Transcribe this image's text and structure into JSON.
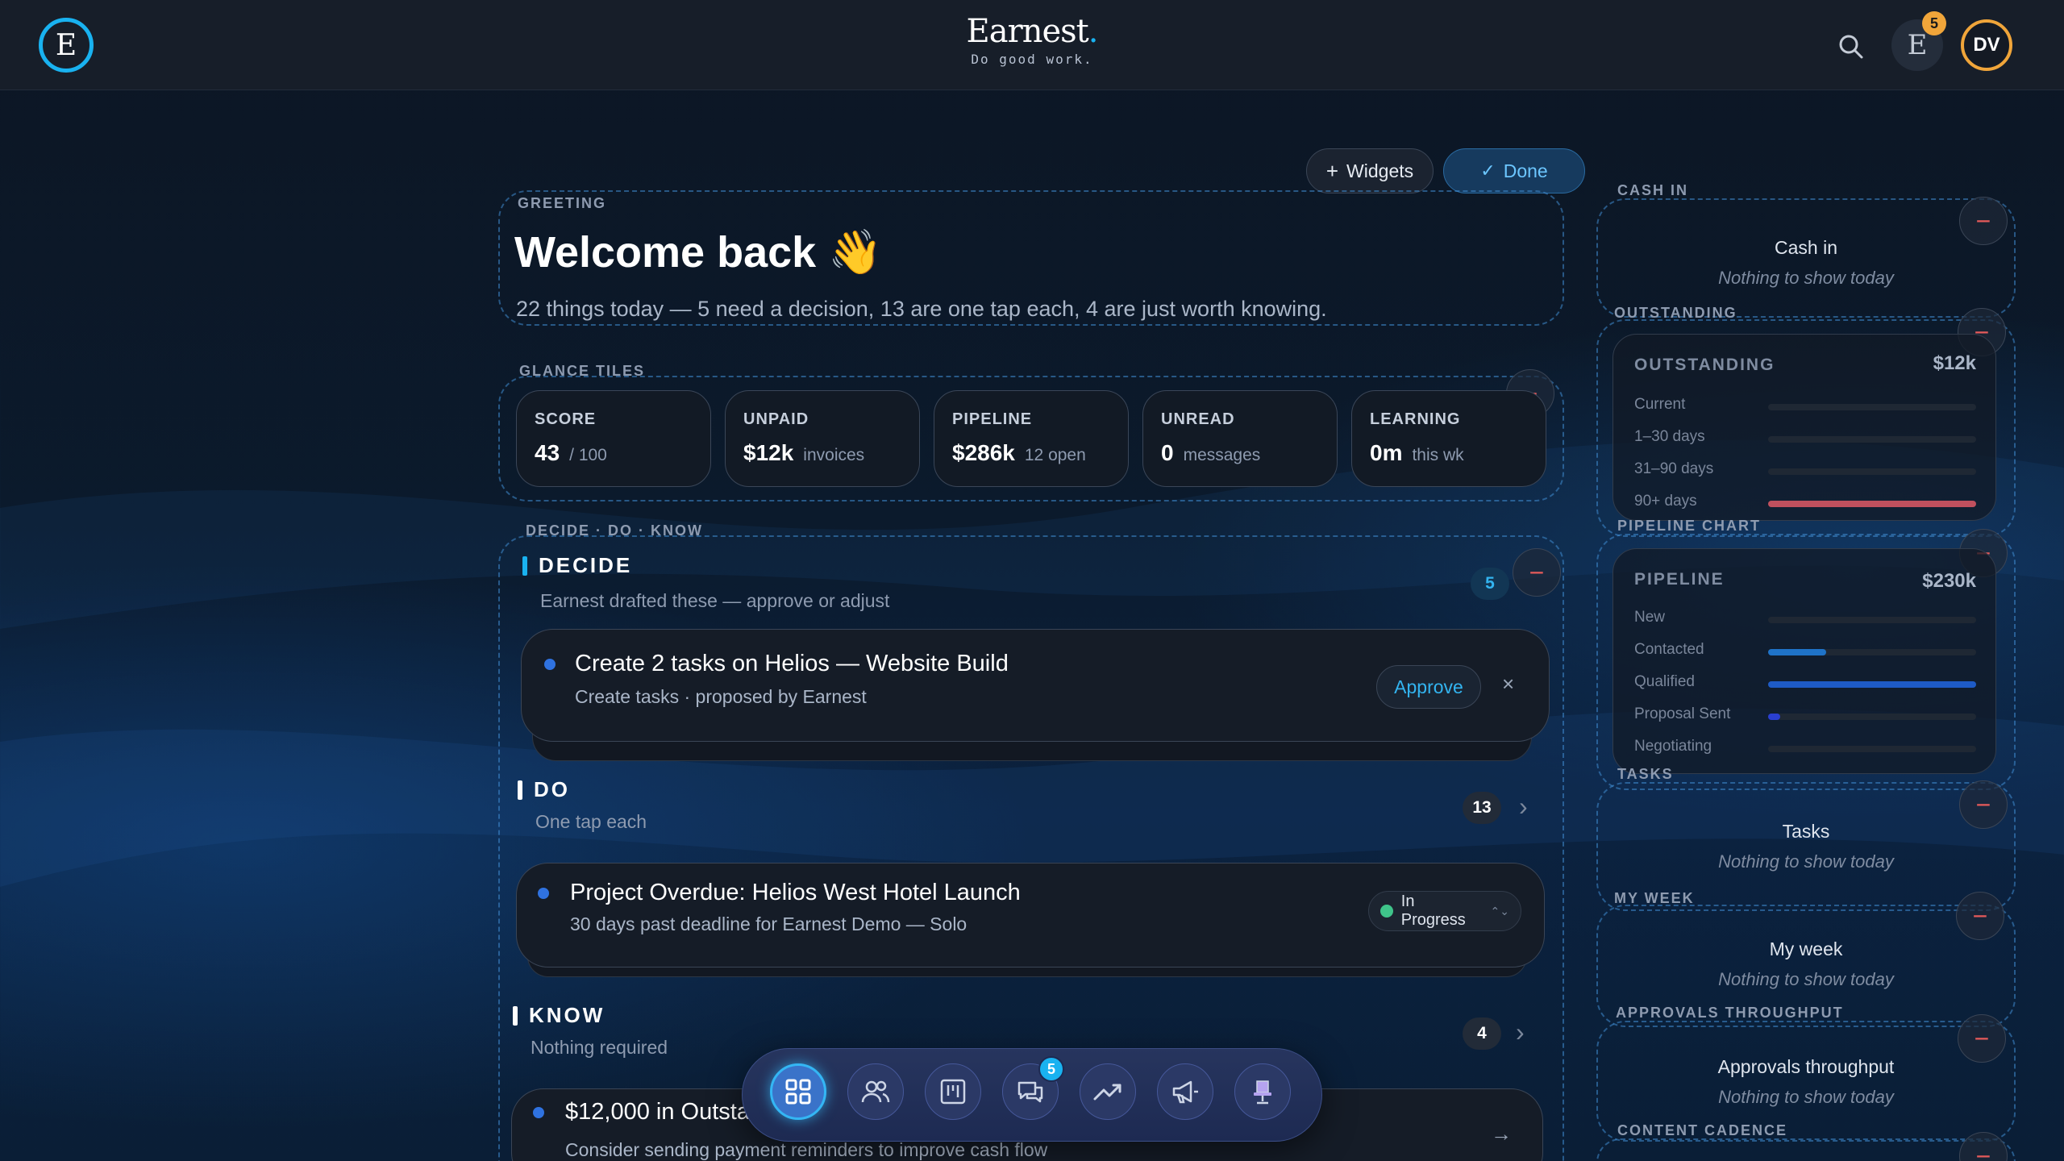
{
  "header": {
    "logo_letter": "E",
    "brand_name": "Earnest",
    "brand_dot": ".",
    "tagline": "Do good work.",
    "notifications": {
      "letter": "E",
      "count": "5"
    },
    "avatar_initials": "DV"
  },
  "toolbar": {
    "widgets_label": "Widgets",
    "done_label": "Done"
  },
  "greeting": {
    "section_label": "GREETING",
    "title": "Welcome back 👋",
    "subtitle": "22 things today — 5 need a decision, 13 are one tap each, 4 are just worth knowing."
  },
  "glance": {
    "section_label": "GLANCE TILES",
    "tiles": [
      {
        "label": "SCORE",
        "value": "43",
        "unit": "/ 100"
      },
      {
        "label": "UNPAID",
        "value": "$12k",
        "unit": "invoices"
      },
      {
        "label": "PIPELINE",
        "value": "$286k",
        "unit": "12 open"
      },
      {
        "label": "UNREAD",
        "value": "0",
        "unit": "messages"
      },
      {
        "label": "LEARNING",
        "value": "0m",
        "unit": "this wk"
      }
    ]
  },
  "ddk": {
    "section_label": "DECIDE · DO · KNOW",
    "decide": {
      "title": "DECIDE",
      "subtitle": "Earnest drafted these — approve or adjust",
      "count": "5",
      "card": {
        "title": "Create 2 tasks on Helios — Website Build",
        "subtitle": "Create tasks · proposed by Earnest",
        "approve_label": "Approve",
        "dismiss": "×"
      }
    },
    "do": {
      "title": "DO",
      "subtitle": "One tap each",
      "count": "13",
      "card": {
        "title": "Project Overdue: Helios West Hotel Launch",
        "subtitle": "30 days past deadline for Earnest Demo — Solo",
        "status": "In Progress"
      }
    },
    "know": {
      "title": "KNOW",
      "subtitle": "Nothing required",
      "count": "4",
      "card": {
        "title": "$12,000 in Outstanding Invoices",
        "subtitle": "Consider sending payment reminders to improve cash flow"
      }
    }
  },
  "dock": {
    "items": [
      "dashboard-icon",
      "people-icon",
      "board-icon",
      "messages-icon",
      "trend-icon",
      "megaphone-icon",
      "chair-icon"
    ],
    "messages_badge": "5"
  },
  "right_column": {
    "cash_in": {
      "section_label": "CASH IN",
      "title": "Cash in",
      "empty": "Nothing to show today"
    },
    "outstanding": {
      "section_label": "OUTSTANDING",
      "panel_title": "OUTSTANDING",
      "total": "$12k",
      "rows": [
        {
          "label": "Current",
          "fraction": 0
        },
        {
          "label": "1–30 days",
          "fraction": 0
        },
        {
          "label": "31–90 days",
          "fraction": 0
        },
        {
          "label": "90+ days",
          "fraction": 1
        }
      ],
      "accent": "#c0505e"
    },
    "pipeline": {
      "section_label": "PIPELINE CHART",
      "panel_title": "PIPELINE",
      "total": "$230k",
      "rows": [
        {
          "label": "New",
          "fraction": 0,
          "color": "#1f5fbf"
        },
        {
          "label": "Contacted",
          "fraction": 0.28,
          "color": "#1f73c8"
        },
        {
          "label": "Qualified",
          "fraction": 1,
          "color": "#1e5bc6"
        },
        {
          "label": "Proposal Sent",
          "fraction": 0.06,
          "color": "#2a3fd0"
        },
        {
          "label": "Negotiating",
          "fraction": 0,
          "color": "#1f5fbf"
        }
      ]
    },
    "tasks": {
      "section_label": "TASKS",
      "title": "Tasks",
      "empty": "Nothing to show today"
    },
    "my_week": {
      "section_label": "MY WEEK",
      "title": "My week",
      "empty": "Nothing to show today"
    },
    "approvals": {
      "section_label": "APPROVALS THROUGHPUT",
      "title": "Approvals throughput",
      "empty": "Nothing to show today"
    },
    "content_cadence": {
      "section_label": "CONTENT CADENCE"
    }
  }
}
